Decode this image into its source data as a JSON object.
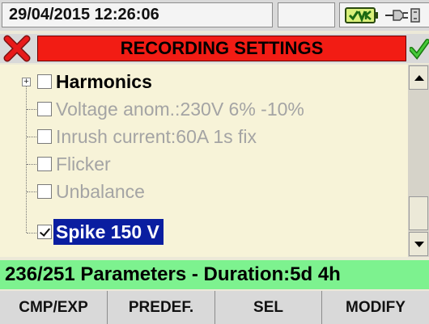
{
  "status_bar": {
    "datetime": "29/04/2015 12:26:06",
    "battery_icon": "battery-icon",
    "plug_icon": "power-plug-icon"
  },
  "title_bar": {
    "title": "RECORDING SETTINGS",
    "close_icon": "close-icon",
    "confirm_icon": "checkmark-icon",
    "title_color": "#f21c14"
  },
  "list": {
    "items": [
      {
        "label": "Harmonics",
        "checked": false,
        "enabled": true,
        "expandable": true,
        "selected": false
      },
      {
        "label": "Voltage anom.:230V 6% -10%",
        "checked": false,
        "enabled": false,
        "expandable": false,
        "selected": false
      },
      {
        "label": "Inrush current:60A 1s fix",
        "checked": false,
        "enabled": false,
        "expandable": false,
        "selected": false
      },
      {
        "label": "Flicker",
        "checked": false,
        "enabled": false,
        "expandable": false,
        "selected": false
      },
      {
        "label": "Unbalance",
        "checked": false,
        "enabled": false,
        "expandable": false,
        "selected": false
      },
      {
        "label": "Spike 150 V",
        "checked": true,
        "enabled": true,
        "expandable": false,
        "selected": true
      }
    ],
    "selection_color": "#0a1ea0",
    "background_color": "#f7f3d8"
  },
  "info_bar": {
    "text": "236/251 Parameters - Duration:5d 4h",
    "color": "#7df28f"
  },
  "function_keys": [
    {
      "label": "CMP/EXP"
    },
    {
      "label": "PREDEF."
    },
    {
      "label": "SEL"
    },
    {
      "label": "MODIFY"
    }
  ]
}
